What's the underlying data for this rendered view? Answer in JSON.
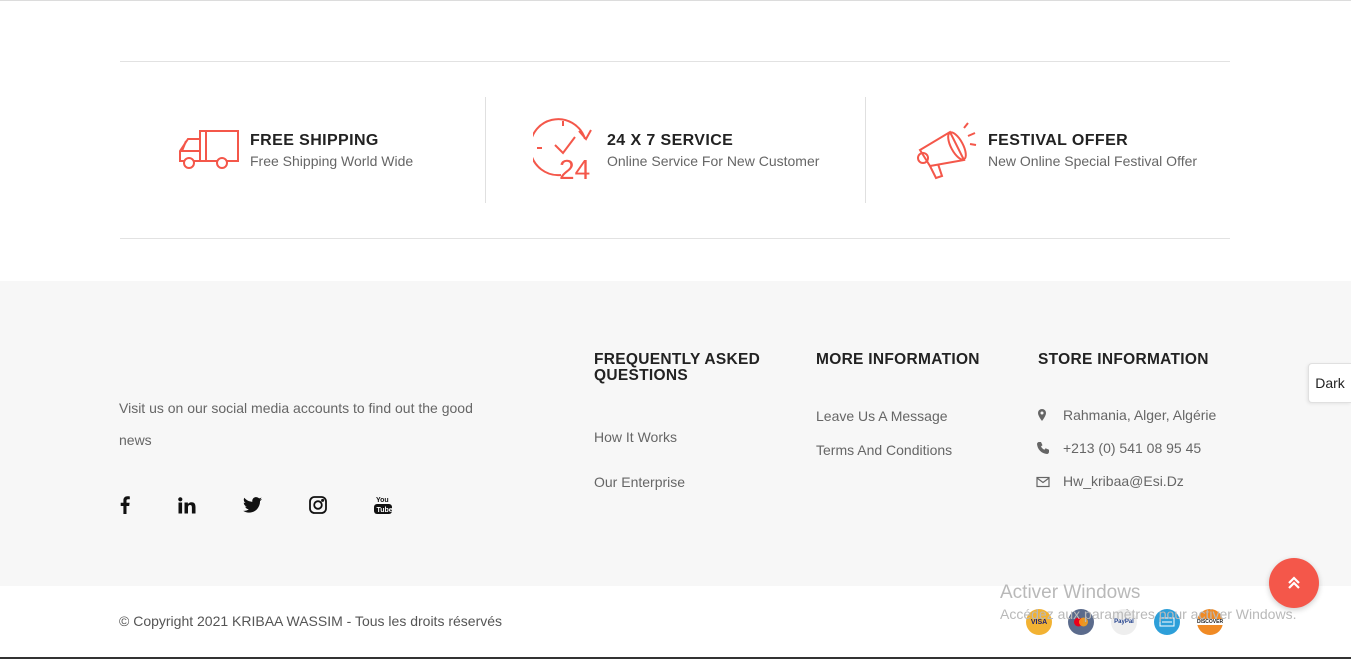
{
  "features": [
    {
      "title": "FREE SHIPPING",
      "subtitle": "Free Shipping World Wide",
      "icon": "truck-icon"
    },
    {
      "title": "24 X 7 SERVICE",
      "subtitle": "Online Service For New Customer",
      "icon": "clock-24-icon"
    },
    {
      "title": "FESTIVAL OFFER",
      "subtitle": "New Online Special Festival Offer",
      "icon": "megaphone-icon"
    }
  ],
  "about": {
    "text": "Visit us on our social media accounts to find out the good news"
  },
  "social": [
    "facebook-icon",
    "linkedin-icon",
    "twitter-icon",
    "instagram-icon",
    "youtube-icon"
  ],
  "faq": {
    "title": "FREQUENTLY ASKED QUESTIONS",
    "links": [
      "How It Works",
      "Our Enterprise"
    ]
  },
  "more_info": {
    "title": "MORE INFORMATION",
    "links": [
      "Leave Us A Message",
      "Terms And Conditions"
    ]
  },
  "store": {
    "title": "STORE INFORMATION",
    "address": "Rahmania, Alger, Algérie",
    "phone": "+213 (0) 541 08 95 45",
    "email": "Hw_kribaa@Esi.Dz"
  },
  "dark_toggle": "Dark",
  "copyright": "© Copyright 2021 KRIBAA WASSIM - Tous les droits réservés",
  "payments": [
    "VISA",
    "MasterCard",
    "PayPal",
    "AmEx",
    "DISCOVER"
  ],
  "watermark": {
    "line1": "Activer Windows",
    "line2": "Accédez aux paramètres pour activer Windows."
  },
  "colors": {
    "accent": "#f4574a",
    "footer_bg": "#f7f7f7"
  }
}
